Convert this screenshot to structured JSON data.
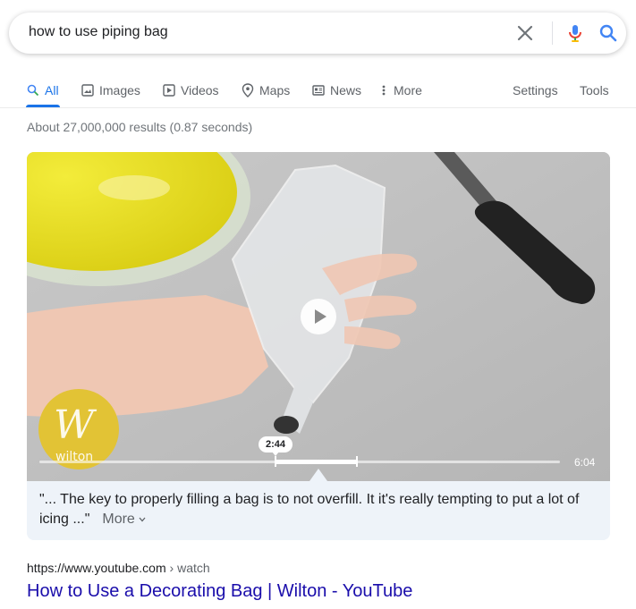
{
  "search": {
    "query": "how to use piping bag"
  },
  "tabs": [
    {
      "label": "All",
      "icon": "search-icon",
      "active": true
    },
    {
      "label": "Images",
      "icon": "image-icon"
    },
    {
      "label": "Videos",
      "icon": "play-icon"
    },
    {
      "label": "Maps",
      "icon": "map-pin-icon"
    },
    {
      "label": "News",
      "icon": "newspaper-icon"
    },
    {
      "label": "More",
      "icon": "more-vert-icon"
    }
  ],
  "tools": {
    "settings": "Settings",
    "tools": "Tools"
  },
  "stats": "About 27,000,000 results (0.87 seconds)",
  "video": {
    "current_time": "2:44",
    "duration": "6:04",
    "progress_start_fraction": 0.45,
    "progress_end_fraction": 0.6,
    "watermark": "wilton"
  },
  "snippet": {
    "text": "\"... The key to properly filling a bag is to not overfill. It it's really tempting to put a lot of icing ...\"",
    "more_label": "More"
  },
  "result": {
    "cite_domain": "https://www.youtube.com",
    "cite_path": " › watch",
    "title": "How to Use a Decorating Bag | Wilton - YouTube"
  },
  "colors": {
    "accent": "#1a73e8",
    "link": "#1a0dab",
    "snippet_bg": "#eef3f9"
  }
}
